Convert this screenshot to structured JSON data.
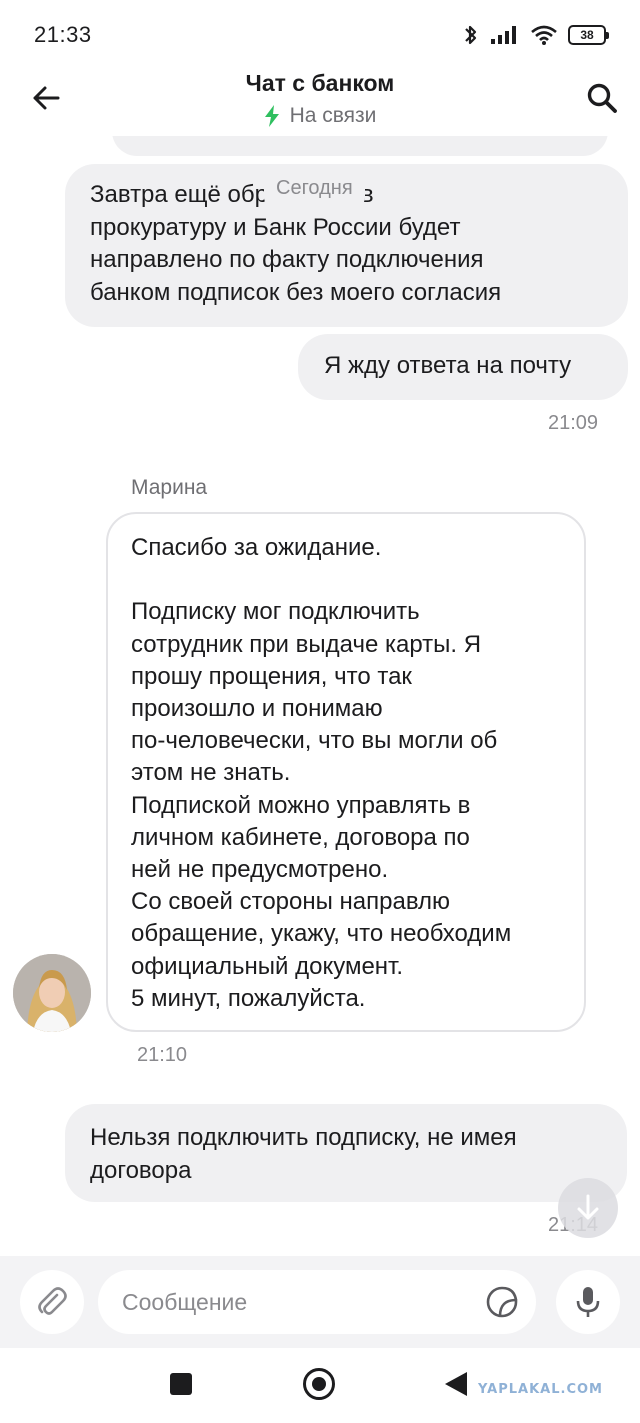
{
  "status_bar": {
    "time": "21:33",
    "battery": "38"
  },
  "header": {
    "title": "Чат с банком",
    "status": "На связи",
    "status_color": "#2fbf5f"
  },
  "chat": {
    "date_separator": "Сегодня",
    "messages": [
      {
        "side": "outgoing",
        "text": "Завтра ещё обращение в\nпрокуратуру и Банк России будет\nнаправлено по факту подключения\nбанком подписок без моего согласия"
      },
      {
        "side": "outgoing",
        "text": "Я жду ответа на почту",
        "time": "21:09"
      },
      {
        "side": "incoming",
        "sender": "Марина",
        "text": "Спасибо за ожидание.\n\nПодписку мог подключить\nсотрудник при выдаче карты. Я\nпрошу прощения, что так\nпроизошло и понимаю\nпо-человечески, что вы могли об\nэтом не знать.\nПодпиской можно управлять в\nличном кабинете, договора по\nней не предусмотрено.\nСо своей стороны направлю\nобращение, укажу, что необходим\nофициальный документ.\n5 минут, пожалуйста.",
        "time": "21:10"
      },
      {
        "side": "outgoing",
        "text": "Нельзя подключить подписку, не имея\nдоговора",
        "time": "21:14"
      }
    ]
  },
  "composer": {
    "placeholder": "Сообщение"
  },
  "watermark": "YAPLAKAL.COM",
  "icons": {
    "back": "arrow-left-icon",
    "search": "search-icon",
    "status": "lightning-icon",
    "attach": "paperclip-icon",
    "sticker": "sticker-icon",
    "mic": "microphone-icon",
    "scroll": "arrow-down-icon"
  }
}
